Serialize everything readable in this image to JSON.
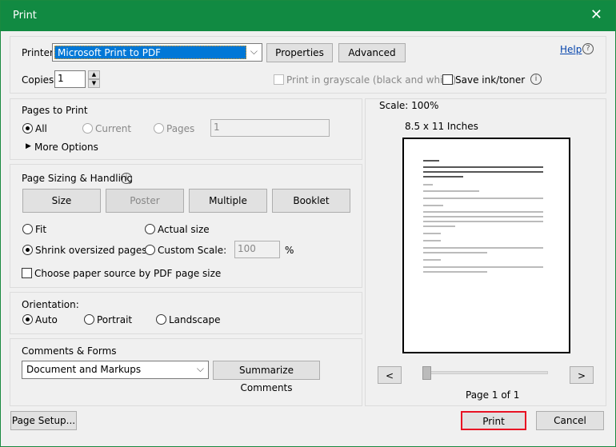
{
  "window": {
    "title": "Print",
    "close_icon": "close-icon"
  },
  "printer": {
    "label": "Printer:",
    "value": "Microsoft Print to PDF",
    "properties": "Properties",
    "advanced": "Advanced",
    "help": "Help"
  },
  "copies": {
    "label": "Copies:",
    "value": "1"
  },
  "options": {
    "grayscale": "Print in grayscale (black and white)",
    "save_ink": "Save ink/toner"
  },
  "pages_to_print": {
    "title": "Pages to Print",
    "all": "All",
    "current": "Current",
    "pages": "Pages",
    "pages_value": "1",
    "more": "More Options"
  },
  "sizing": {
    "title": "Page Sizing & Handling",
    "size": "Size",
    "poster": "Poster",
    "multiple": "Multiple",
    "booklet": "Booklet",
    "fit": "Fit",
    "actual": "Actual size",
    "shrink": "Shrink oversized pages",
    "custom": "Custom Scale:",
    "scale_value": "100",
    "percent": "%",
    "paper_source": "Choose paper source by PDF page size"
  },
  "orientation": {
    "title": "Orientation:",
    "auto": "Auto",
    "portrait": "Portrait",
    "landscape": "Landscape"
  },
  "comments": {
    "title": "Comments & Forms",
    "value": "Document and Markups",
    "summarize": "Summarize Comments"
  },
  "preview": {
    "scale": "Scale: 100%",
    "paper": "8.5 x 11 Inches",
    "page_info": "Page 1 of 1",
    "prev": "<",
    "next": ">"
  },
  "footer": {
    "page_setup": "Page Setup...",
    "print": "Print",
    "cancel": "Cancel"
  },
  "colors": {
    "title_bar": "#118a42",
    "selection": "#0078d7",
    "print_highlight": "#e81123"
  }
}
